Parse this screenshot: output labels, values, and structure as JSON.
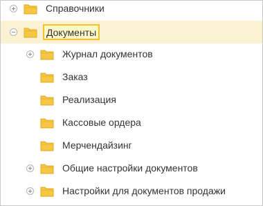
{
  "tree": {
    "top_items": [
      {
        "label": "Справочники",
        "expanded": false
      },
      {
        "label": "Документы",
        "expanded": true,
        "selected": true
      }
    ],
    "children": [
      {
        "label": "Журнал документов",
        "expandable": true
      },
      {
        "label": "Заказ",
        "expandable": false
      },
      {
        "label": "Реализация",
        "expandable": false
      },
      {
        "label": "Кассовые ордера",
        "expandable": false
      },
      {
        "label": "Мерчендайзинг",
        "expandable": false
      },
      {
        "label": "Общие настройки документов",
        "expandable": true
      },
      {
        "label": "Настройки для документов продажи",
        "expandable": true
      }
    ]
  },
  "icons": {
    "folder": "folder-icon",
    "expand": "expand-plus-icon",
    "collapse": "collapse-minus-icon"
  },
  "colors": {
    "folder_fill": "#f5c744",
    "folder_stroke": "#e0a91c",
    "selection_row": "#fbf2d3",
    "selection_border": "#f2c22b"
  }
}
